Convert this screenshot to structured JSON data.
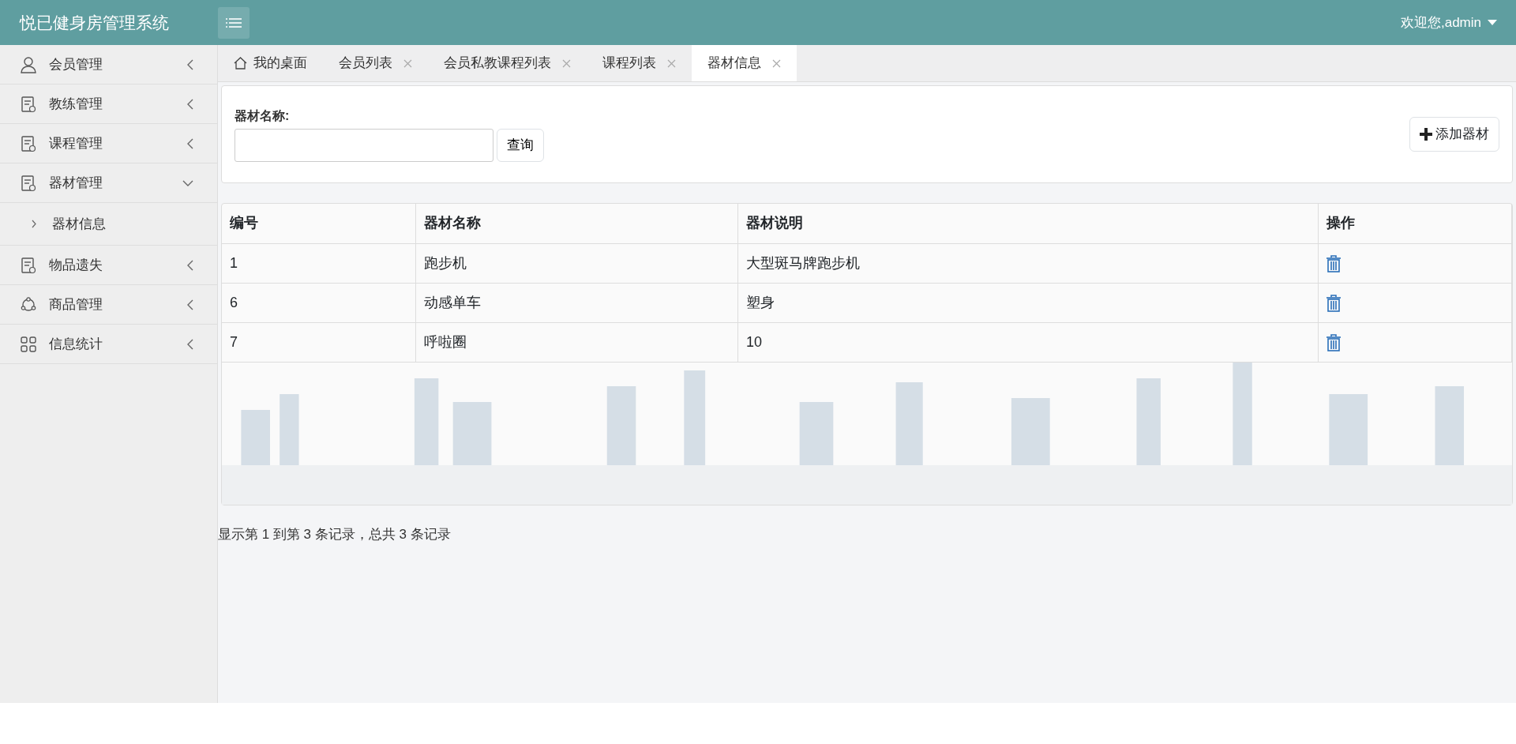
{
  "header": {
    "title": "悦已健身房管理系统",
    "user": "欢迎您,admin"
  },
  "sidebar": {
    "items": [
      {
        "label": "会员管理",
        "kind": "person",
        "expanded": false
      },
      {
        "label": "教练管理",
        "kind": "doc",
        "expanded": false
      },
      {
        "label": "课程管理",
        "kind": "doc",
        "expanded": false
      },
      {
        "label": "器材管理",
        "kind": "doc",
        "expanded": true,
        "children": [
          {
            "label": "器材信息"
          }
        ]
      },
      {
        "label": "物品遗失",
        "kind": "doc",
        "expanded": false
      },
      {
        "label": "商品管理",
        "kind": "ring",
        "expanded": false
      },
      {
        "label": "信息统计",
        "kind": "grid",
        "expanded": false
      }
    ]
  },
  "tabs": [
    {
      "label": "我的桌面",
      "kind": "home",
      "selected": false
    },
    {
      "label": "会员列表",
      "kind": "closable",
      "selected": false
    },
    {
      "label": "会员私教课程列表",
      "kind": "closable",
      "selected": false
    },
    {
      "label": "课程列表",
      "kind": "closable",
      "selected": false
    },
    {
      "label": "器材信息",
      "kind": "closable",
      "selected": true
    }
  ],
  "search": {
    "label": "器材名称:",
    "button": "查询",
    "add_button": "添加器材"
  },
  "table": {
    "columns": [
      "编号",
      "器材名称",
      "器材说明",
      "操作"
    ],
    "rows": [
      {
        "id": "1",
        "name": "跑步机",
        "description": "大型斑马牌跑步机"
      },
      {
        "id": "6",
        "name": "动感单车",
        "description": "塑身"
      },
      {
        "id": "7",
        "name": "呼啦圈",
        "description": "10"
      }
    ]
  },
  "pagination": "显示第 1 到第 3 条记录，总共 3 条记录"
}
